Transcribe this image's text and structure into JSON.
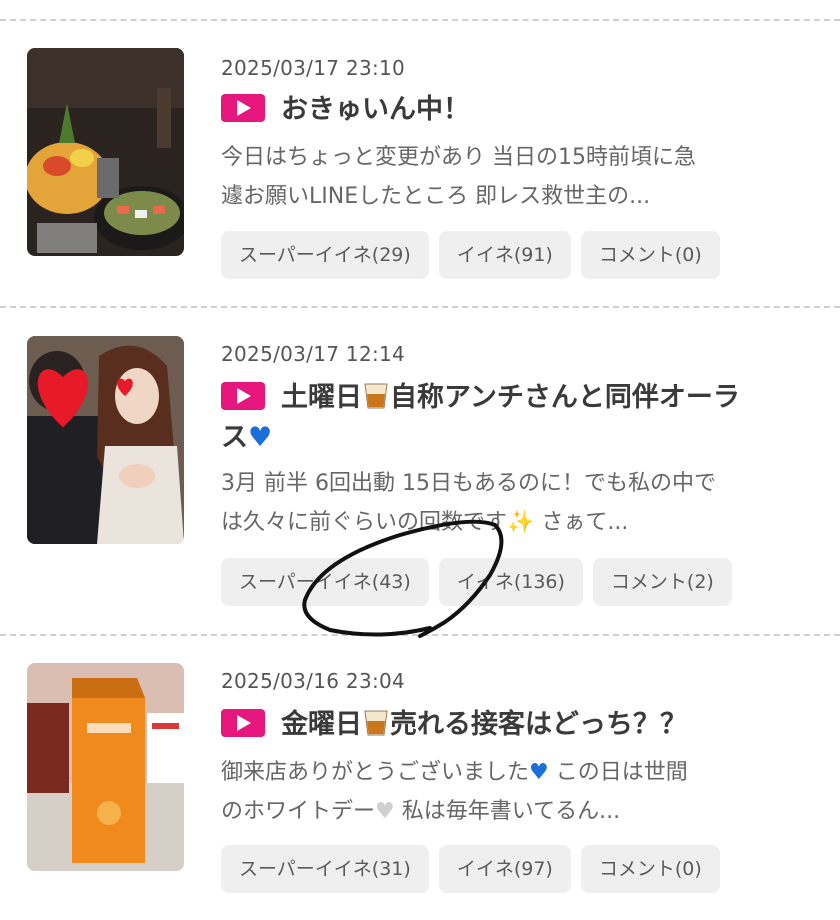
{
  "posts": [
    {
      "date": "2025/03/17 23:10",
      "title": "おきゅいん中！",
      "excerpt_line1": "今日はちょっと変更があり 当日の15時前頃に急",
      "excerpt_line2": "遽お願いLINEしたところ 即レス救世主の...",
      "super_like_label": "スーパーイイネ(29)",
      "like_label": "イイネ(91)",
      "comment_label": "コメント(0)"
    },
    {
      "date": "2025/03/17 12:14",
      "title_part1": "土曜日",
      "title_part2": "自称アンチさんと同伴オーラ",
      "title_part3": "ス",
      "excerpt_line1": "3月 前半 6回出動 15日もあるのに！でも私の中で",
      "excerpt_line2": "は久々に前ぐらいの回数です✨ さぁて...",
      "super_like_label": "スーパーイイネ(43)",
      "like_label": "イイネ(136)",
      "comment_label": "コメント(2)"
    },
    {
      "date": "2025/03/16 23:04",
      "title_part1": "金曜日",
      "title_part2": "売れる接客はどっち？？",
      "excerpt_line1": " 御来店ありがとうございました",
      "excerpt_line1b": " この日は世間",
      "excerpt_line2": "のホワイトデー",
      "excerpt_line2b": " 私は毎年書いてるん...",
      "super_like_label": "スーパーイイネ(31)",
      "like_label": "イイネ(97)",
      "comment_label": "コメント(0)"
    }
  ],
  "colors": {
    "play_badge": "#e5177d",
    "button_bg": "#efefef",
    "divider": "#cfcfcf"
  },
  "icons": [
    "play-icon",
    "whiskey-glass-icon",
    "blue-heart-icon",
    "white-heart-icon",
    "sparkles-icon"
  ]
}
